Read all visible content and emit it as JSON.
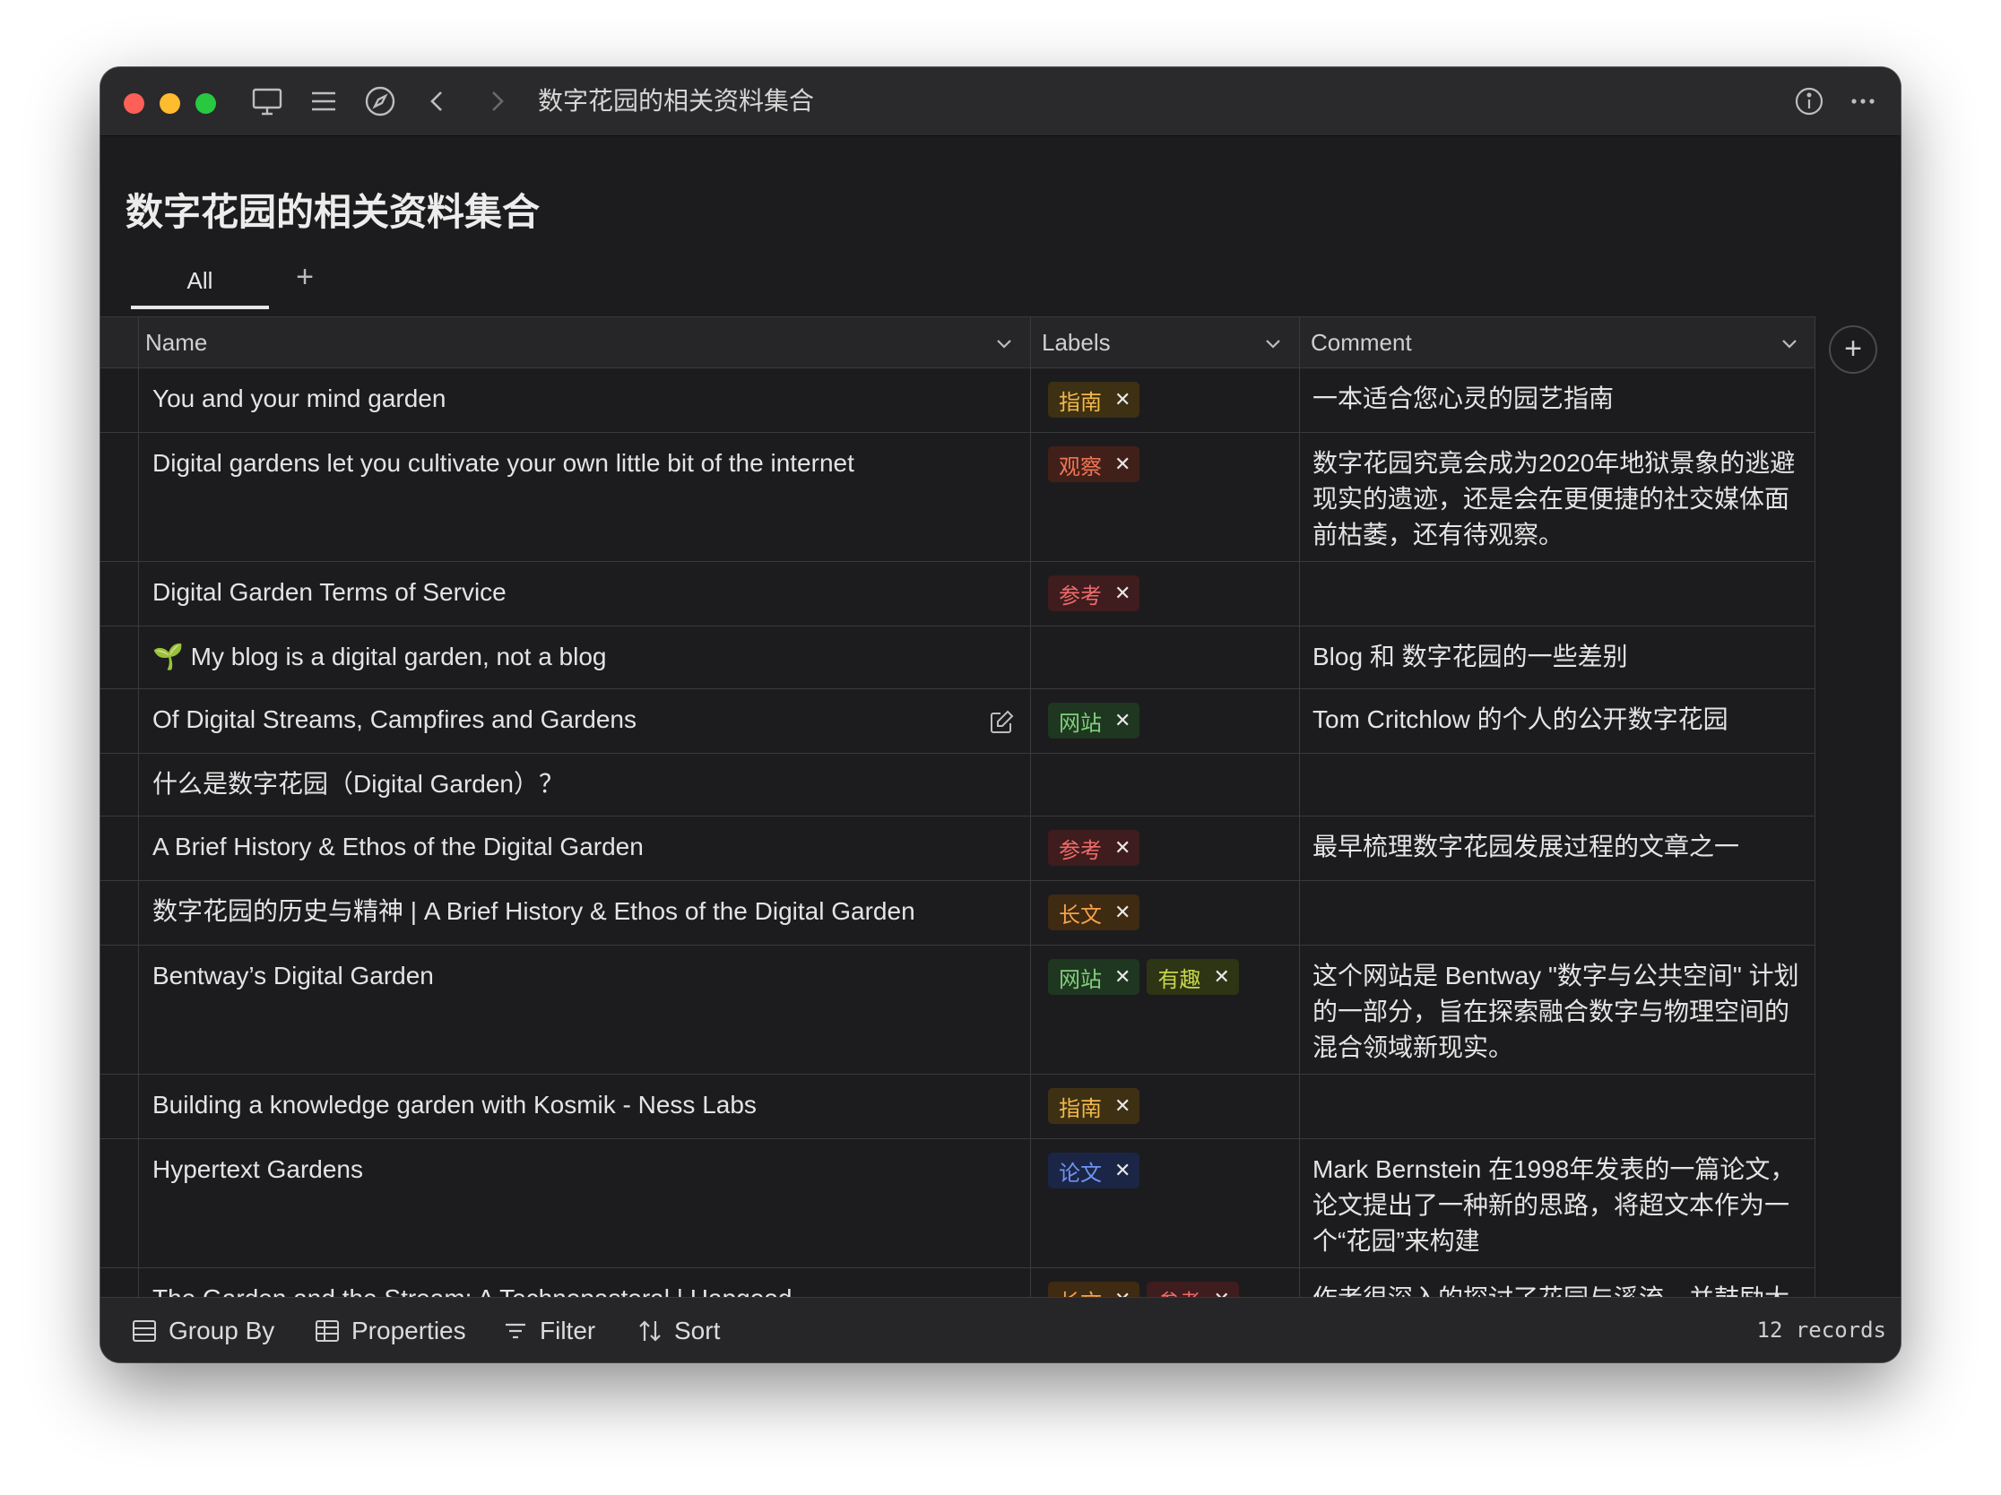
{
  "window": {
    "title": "数字花园的相关资料集合"
  },
  "page": {
    "title": "数字花园的相关资料集合"
  },
  "tabs": [
    {
      "label": "All",
      "active": true
    }
  ],
  "tab_add_label": "+",
  "columns": {
    "name": "Name",
    "labels": "Labels",
    "comment": "Comment"
  },
  "add_column_label": "+",
  "tag_colors": {
    "指南": {
      "bg": "#3d3013",
      "fg": "#f2b84b"
    },
    "观察": {
      "bg": "#42201a",
      "fg": "#f07555"
    },
    "参考": {
      "bg": "#3f1c1d",
      "fg": "#ef6b6b"
    },
    "网站": {
      "bg": "#1f3620",
      "fg": "#7fd07a"
    },
    "长文": {
      "bg": "#3f2a12",
      "fg": "#f3a24a"
    },
    "有趣": {
      "bg": "#2e3514",
      "fg": "#c8d64c"
    },
    "论文": {
      "bg": "#1b2545",
      "fg": "#6f93f2"
    }
  },
  "rows": [
    {
      "name": "You and your mind garden",
      "labels": [
        "指南"
      ],
      "comment": "一本适合您心灵的园艺指南",
      "height": 72
    },
    {
      "name": "Digital gardens let you cultivate your own little bit of the internet",
      "labels": [
        "观察"
      ],
      "comment": "数字花园究竟会成为2020年地狱景象的逃避现实的遗迹，还是会在更便捷的社交媒体面前枯萎，还有待观察。",
      "height": 144
    },
    {
      "name": "Digital Garden Terms of Service",
      "labels": [
        "参考"
      ],
      "comment": "",
      "height": 72
    },
    {
      "name": "🌱 My blog is a digital garden, not a blog",
      "labels": [],
      "comment": "Blog 和 数字花园的一些差别",
      "height": 70
    },
    {
      "name": "Of Digital Streams, Campfires and Gardens",
      "labels": [
        "网站"
      ],
      "comment": "Tom Critchlow 的个人的公开数字花园",
      "height": 72,
      "edit": true
    },
    {
      "name": "什么是数字花园（Digital Garden）？",
      "labels": [],
      "comment": "",
      "height": 70
    },
    {
      "name": "A Brief History & Ethos of the Digital Garden",
      "labels": [
        "参考"
      ],
      "comment": "最早梳理数字花园发展过程的文章之一",
      "height": 72
    },
    {
      "name": "数字花园的历史与精神 | A Brief History & Ethos of the Digital Garden",
      "labels": [
        "长文"
      ],
      "comment": "",
      "height": 72
    },
    {
      "name": "Bentway’s Digital Garden",
      "labels": [
        "网站",
        "有趣"
      ],
      "comment": "这个网站是  Bentway \"数字与公共空间\" 计划的一部分，旨在探索融合数字与物理空间的混合领域新现实。",
      "height": 144
    },
    {
      "name": "Building a knowledge garden with Kosmik - Ness Labs",
      "labels": [
        "指南"
      ],
      "comment": "",
      "height": 72
    },
    {
      "name": "Hypertext Gardens",
      "labels": [
        "论文"
      ],
      "comment": "Mark Bernstein 在1998年发表的一篇论文，论文提出了一种新的思路，将超文本作为一个“花园”来构建",
      "height": 144
    },
    {
      "name": "The Garden and the Stream: A Technopastoral | Hapgood",
      "labels": [
        "长文",
        "参考"
      ],
      "comment": "作者很深入的探讨了花园与溪流，并鼓励大",
      "height": 100
    }
  ],
  "footer": {
    "group_by": "Group By",
    "properties": "Properties",
    "filter": "Filter",
    "sort": "Sort",
    "records": "12 records"
  }
}
